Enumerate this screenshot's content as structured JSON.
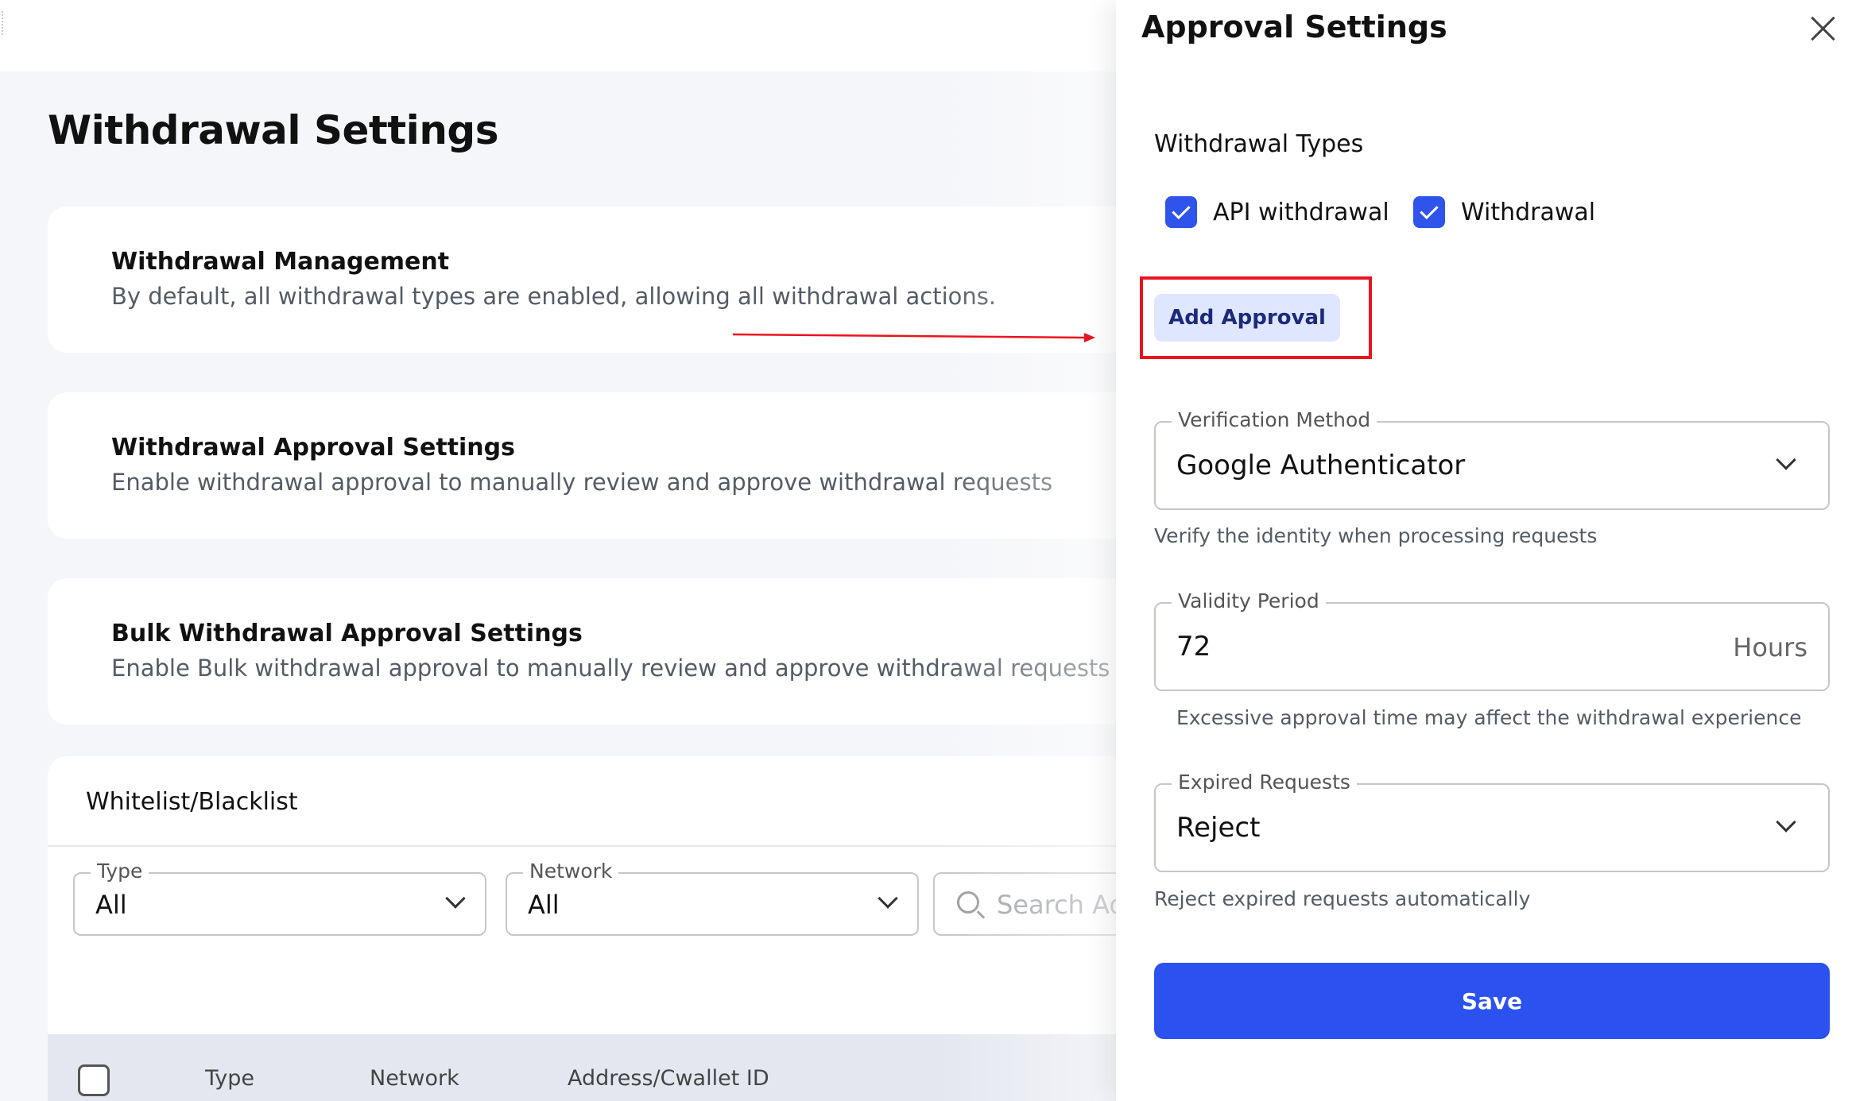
{
  "page": {
    "title": "Withdrawal Settings",
    "cards": [
      {
        "title": "Withdrawal Management",
        "description": "By default, all withdrawal types are enabled, allowing all withdrawal actions."
      },
      {
        "title": "Withdrawal Approval Settings",
        "description": "Enable withdrawal approval to manually review and approve withdrawal requests"
      },
      {
        "title": "Bulk Withdrawal Approval Settings",
        "description": "Enable Bulk withdrawal approval to manually review and approve withdrawal requests"
      }
    ],
    "whitelist": {
      "title": "Whitelist/Blacklist",
      "filters": {
        "type": {
          "label": "Type",
          "value": "All"
        },
        "network": {
          "label": "Network",
          "value": "All"
        }
      },
      "search_placeholder": "Search Address",
      "search_visible_text": "Search Add",
      "columns": [
        "Type",
        "Network",
        "Address/Cwallet ID"
      ]
    }
  },
  "drawer": {
    "title": "Approval Settings",
    "withdrawal_types_label": "Withdrawal Types",
    "withdrawal_types": [
      {
        "label": "API withdrawal",
        "checked": true
      },
      {
        "label": "Withdrawal",
        "checked": true
      }
    ],
    "add_approval_label": "Add Approval",
    "verification": {
      "label": "Verification Method",
      "value": "Google Authenticator",
      "helper": "Verify the identity when processing requests"
    },
    "validity": {
      "label": "Validity Period",
      "value": "72",
      "suffix": "Hours",
      "helper": "Excessive approval time may affect the withdrawal experience"
    },
    "expired": {
      "label": "Expired Requests",
      "value": "Reject",
      "helper": "Reject expired requests automatically"
    },
    "save_label": "Save"
  },
  "colors": {
    "primary": "#2b52ef",
    "checkbox": "#2f54eb",
    "add_approval_bg": "#dfe6ff",
    "annotation_red": "#e8141e",
    "content_bg": "#f5f6f9"
  }
}
